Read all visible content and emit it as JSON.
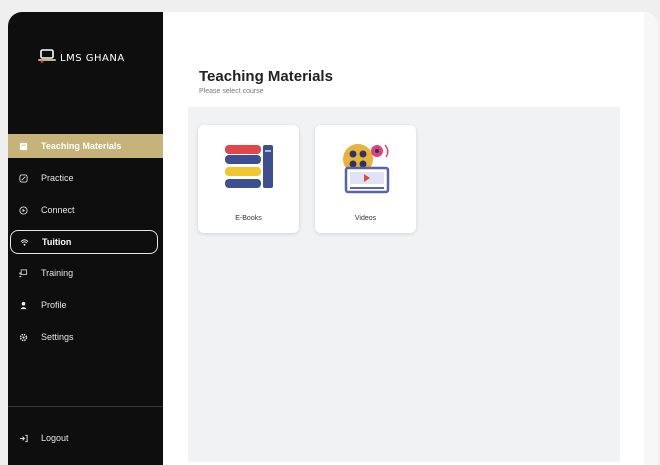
{
  "app": {
    "brand": "LMS GHANA"
  },
  "sidebar": {
    "items": [
      {
        "label": "Teaching Materials",
        "icon": "book-icon"
      },
      {
        "label": "Practice",
        "icon": "edit-icon"
      },
      {
        "label": "Connect",
        "icon": "play-icon"
      },
      {
        "label": "Tuition",
        "icon": "wifi-icon"
      },
      {
        "label": "Training",
        "icon": "presentation-icon"
      },
      {
        "label": "Profile",
        "icon": "user-icon"
      },
      {
        "label": "Settings",
        "icon": "gear-icon"
      }
    ],
    "logout_label": "Logout"
  },
  "main": {
    "title": "Teaching Materials",
    "subtitle": "Please select course",
    "cards": [
      {
        "label": "E-Books",
        "icon": "books-icon"
      },
      {
        "label": "Videos",
        "icon": "video-reel-icon"
      }
    ]
  },
  "colors": {
    "accent": "#c6b37a",
    "sidebar_bg": "#0e0e0e",
    "panel_bg": "#f1f2f3"
  }
}
